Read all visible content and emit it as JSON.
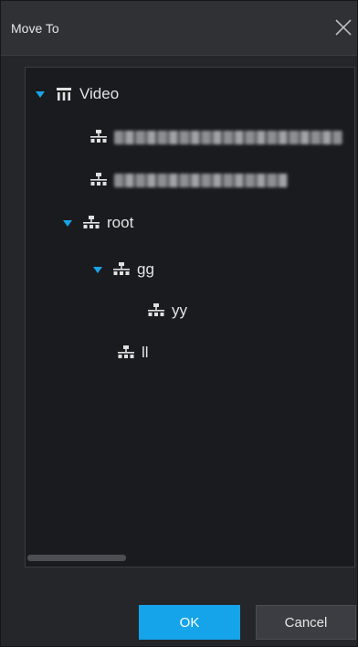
{
  "dialog": {
    "title": "Move To",
    "close_icon": "close-icon"
  },
  "tree": {
    "root": {
      "label": "Video",
      "icon": "video-root-icon",
      "expanded": true
    },
    "items": [
      {
        "label": "",
        "blurred": true,
        "icon": "org-node-icon"
      },
      {
        "label": "",
        "blurred": true,
        "icon": "org-node-icon"
      },
      {
        "label": "root",
        "icon": "org-node-icon",
        "expanded": true
      },
      {
        "label": "gg",
        "icon": "org-node-icon",
        "expanded": true
      },
      {
        "label": "yy",
        "icon": "org-node-icon"
      },
      {
        "label": "ll",
        "icon": "org-node-icon"
      }
    ]
  },
  "buttons": {
    "ok_label": "OK",
    "cancel_label": "Cancel"
  },
  "colors": {
    "accent": "#15a4ea",
    "toggle": "#1aa3e8",
    "background": "#24262a"
  }
}
